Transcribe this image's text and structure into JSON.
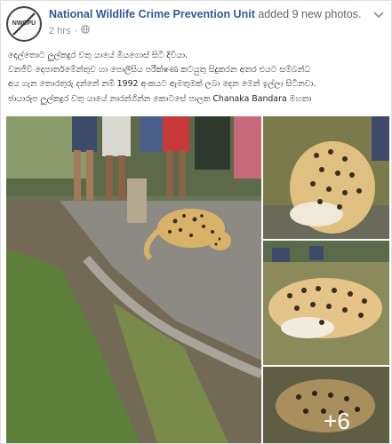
{
  "post": {
    "page_name": "National Wildlife Crime Prevention Unit",
    "action": "added 9 new photos.",
    "time": "2 hrs",
    "separator": "·",
    "avatar_text": "NWCPU",
    "avatar_subtext": "ශ්‍රී ලංකාව",
    "privacy_icon": "globe-icon",
    "options_icon": "chevron-down-icon",
    "text_lines": [
      "දෙල්තොට ලුල්කදුර වතු යායේ මියගොස් සිටි දිවියා.",
      "වනජීවි දෙපාර්තමේන්තුව හා පොලීසිය පරීක්ෂණ කටයුතු සිදුකරන අතර එයට සම්බන්ධ",
      "අය ගැන තොරතුරු දන්නේ නම් 1992 අංකයට ඇමතුමක් ලබා දෙන මෙන් ඉල්ලා සිටිනවා.",
      "ඡායාරූප ලුල්කදුර වතු යායේ නාරන්ගින්න කොටසේ පාලක Chanaka Bandara මහතා"
    ]
  },
  "photos": {
    "more_count": "+6",
    "items": [
      {
        "name": "leopard-crowd-photo"
      },
      {
        "name": "leopard-closeup-photo-1"
      },
      {
        "name": "leopard-closeup-photo-2"
      },
      {
        "name": "leopard-closeup-photo-3"
      }
    ]
  },
  "colors": {
    "link": "#365899",
    "meta": "#90949c",
    "leopard": "#d9b26a",
    "grass": "#5c7f3a"
  }
}
